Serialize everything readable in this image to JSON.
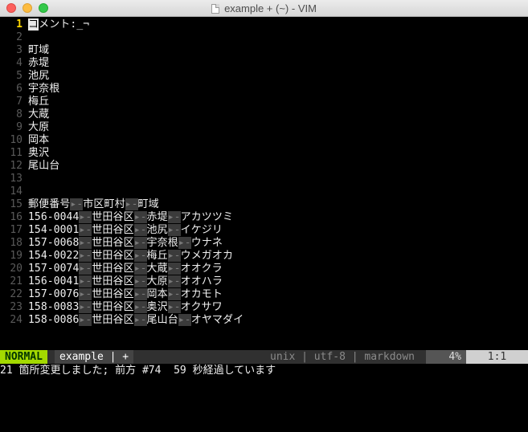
{
  "window": {
    "title": "example + (~) - VIM"
  },
  "lines": [
    {
      "num": "1",
      "current": true,
      "cursor_char": "コ",
      "rest": "メント:_¬"
    },
    {
      "num": "2",
      "text": ""
    },
    {
      "num": "3",
      "text": "町域"
    },
    {
      "num": "4",
      "text": "赤堤"
    },
    {
      "num": "5",
      "text": "池尻"
    },
    {
      "num": "6",
      "text": "宇奈根"
    },
    {
      "num": "7",
      "text": "梅丘"
    },
    {
      "num": "8",
      "text": "大蔵"
    },
    {
      "num": "9",
      "text": "大原"
    },
    {
      "num": "10",
      "text": "岡本"
    },
    {
      "num": "11",
      "text": "奥沢"
    },
    {
      "num": "12",
      "text": "尾山台"
    },
    {
      "num": "13",
      "text": ""
    },
    {
      "num": "14",
      "text": ""
    },
    {
      "num": "15",
      "cells": [
        "郵便番号",
        "市区町村",
        "町域"
      ]
    },
    {
      "num": "16",
      "cells": [
        "156-0044",
        "世田谷区",
        "赤堤",
        "アカツツミ"
      ]
    },
    {
      "num": "17",
      "cells": [
        "154-0001",
        "世田谷区",
        "池尻",
        "イケジリ"
      ]
    },
    {
      "num": "18",
      "cells": [
        "157-0068",
        "世田谷区",
        "宇奈根",
        "ウナネ"
      ]
    },
    {
      "num": "19",
      "cells": [
        "154-0022",
        "世田谷区",
        "梅丘",
        "ウメガオカ"
      ]
    },
    {
      "num": "20",
      "cells": [
        "157-0074",
        "世田谷区",
        "大蔵",
        "オオクラ"
      ]
    },
    {
      "num": "21",
      "cells": [
        "156-0041",
        "世田谷区",
        "大原",
        "オオハラ"
      ]
    },
    {
      "num": "22",
      "cells": [
        "157-0076",
        "世田谷区",
        "岡本",
        "オカモト"
      ]
    },
    {
      "num": "23",
      "cells": [
        "158-0083",
        "世田谷区",
        "奥沢",
        "オクサワ"
      ]
    },
    {
      "num": "24",
      "cells": [
        "158-0086",
        "世田谷区",
        "尾山台",
        "オヤマダイ"
      ]
    }
  ],
  "tab_glyph": "▸-",
  "statusline": {
    "mode": "NORMAL",
    "file": "example | +",
    "fileinfo": "unix | utf-8 | markdown",
    "percent": "4%",
    "position": "1:1"
  },
  "message": "21 箇所変更しました; 前方 #74  59 秒経過しています",
  "colors": {
    "mode_bg": "#a3d900",
    "current_line_number": "#ffd700",
    "background": "#000000"
  }
}
